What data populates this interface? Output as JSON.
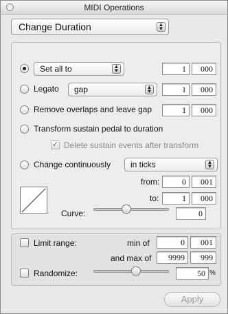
{
  "window": {
    "title": "MIDI Operations"
  },
  "operation": {
    "selected": "Change Duration"
  },
  "options": {
    "set_all": {
      "popup": "Set all to",
      "val1": "1",
      "val2": "000"
    },
    "legato": {
      "label": "Legato",
      "popup": "gap",
      "val1": "1",
      "val2": "000"
    },
    "remove_overlaps": {
      "label": "Remove overlaps and leave gap",
      "val1": "1",
      "val2": "000"
    },
    "sustain": {
      "label": "Transform sustain pedal to duration",
      "delete_label": "Delete sustain events after transform",
      "delete_checked": true
    },
    "continuous": {
      "label": "Change continuously",
      "popup": "in ticks",
      "from_label": "from:",
      "from1": "0",
      "from2": "001",
      "to_label": "to:",
      "to1": "1",
      "to2": "000",
      "curve_label": "Curve:",
      "curve_value": "0"
    }
  },
  "limits": {
    "limit_label": "Limit range:",
    "min_label": "min of",
    "min1": "0",
    "min2": "001",
    "max_label": "and max of",
    "max1": "9999",
    "max2": "999",
    "randomize_label": "Randomize:",
    "randomize_value": "50",
    "randomize_unit": "%"
  },
  "apply_label": "Apply",
  "selected_option": "set_all"
}
